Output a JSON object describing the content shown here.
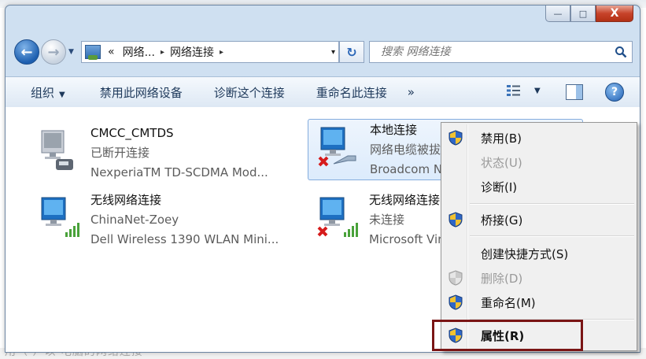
{
  "window": {
    "caption": {
      "minimize": "—",
      "maximize": "□",
      "close": "X"
    }
  },
  "address_bar": {
    "segments": [
      "«",
      "网络...",
      "▸",
      "网络连接",
      "▸"
    ],
    "dropdown": "▾"
  },
  "search": {
    "placeholder": "搜索 网络连接"
  },
  "command_bar": {
    "organize": "组织",
    "disable_device": "禁用此网络设备",
    "diagnose": "诊断这个连接",
    "rename": "重命名此连接",
    "more": "»"
  },
  "connections": [
    {
      "name": "CMCC_CMTDS",
      "status": "已断开连接",
      "device": "NexperiaTM TD-SCDMA Mod...",
      "icon": "modem-connection-icon",
      "disabled_mark": false
    },
    {
      "name": "本地连接",
      "status": "网络电缆被拔出",
      "device": "Broadcom NetLink",
      "icon": "ethernet-connection-icon",
      "disabled_mark": true
    },
    {
      "name": "无线网络连接",
      "status": "ChinaNet-Zoey",
      "device": "Dell Wireless 1390 WLAN Mini...",
      "icon": "wireless-connection-icon",
      "disabled_mark": false
    },
    {
      "name": "无线网络连接",
      "status": "未连接",
      "device": "Microsoft Virtual",
      "icon": "wireless-connection-icon",
      "disabled_mark": true
    }
  ],
  "context_menu": {
    "items": [
      {
        "label": "禁用(B)",
        "shield": true,
        "disabled": false
      },
      {
        "label": "状态(U)",
        "shield": false,
        "disabled": true
      },
      {
        "label": "诊断(I)",
        "shield": false,
        "disabled": false
      },
      {
        "label": "桥接(G)",
        "shield": true,
        "disabled": false
      },
      {
        "label": "创建快捷方式(S)",
        "shield": false,
        "disabled": false
      },
      {
        "label": "删除(D)",
        "shield": true,
        "disabled": true
      },
      {
        "label": "重命名(M)",
        "shield": true,
        "disabled": false
      },
      {
        "label": "属性(R)",
        "shield": true,
        "disabled": false,
        "bold": true
      }
    ]
  },
  "background_text": "用（ ）以 电脑的网络连接",
  "colors": {
    "highlight_box": "#7a1515",
    "selection": "#dcebfc"
  }
}
